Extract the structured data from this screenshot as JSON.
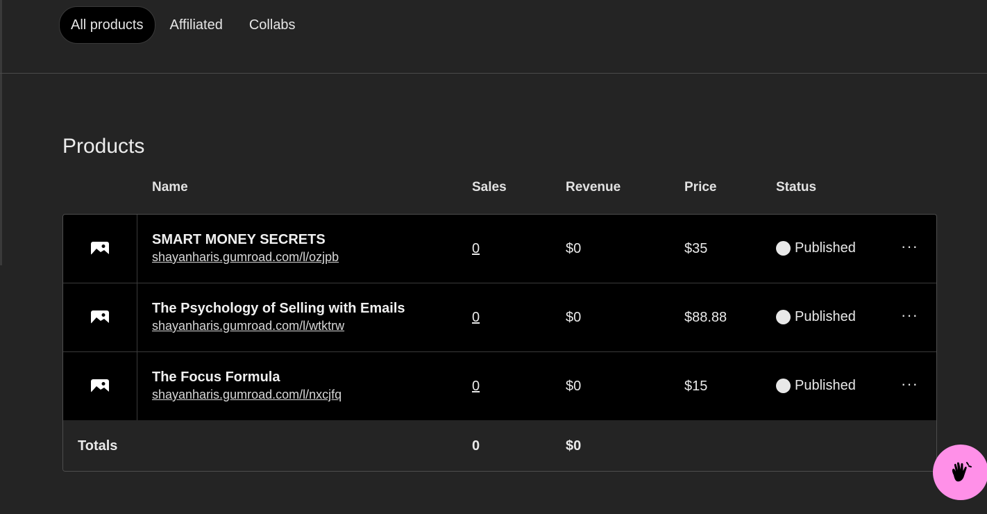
{
  "tabs": [
    {
      "label": "All products",
      "active": true
    },
    {
      "label": "Affiliated",
      "active": false
    },
    {
      "label": "Collabs",
      "active": false
    }
  ],
  "section_title": "Products",
  "columns": {
    "name": "Name",
    "sales": "Sales",
    "revenue": "Revenue",
    "price": "Price",
    "status": "Status"
  },
  "products": [
    {
      "name": "SMART MONEY SECRETS",
      "url": "shayanharis.gumroad.com/l/ozjpb",
      "sales": "0",
      "revenue": "$0",
      "price": "$35",
      "status": "Published",
      "more": "···"
    },
    {
      "name": "The Psychology of Selling with Emails",
      "url": "shayanharis.gumroad.com/l/wtktrw",
      "sales": "0",
      "revenue": "$0",
      "price": "$88.88",
      "status": "Published",
      "more": "···"
    },
    {
      "name": "The Focus Formula",
      "url": "shayanharis.gumroad.com/l/nxcjfq",
      "sales": "0",
      "revenue": "$0",
      "price": "$15",
      "status": "Published",
      "more": "···"
    }
  ],
  "totals": {
    "label": "Totals",
    "sales": "0",
    "revenue": "$0"
  },
  "icons": {
    "thumbnail": "image-placeholder-icon",
    "status": "published-dot-icon",
    "more": "more-horizontal-icon",
    "help": "wave-hand-icon"
  },
  "colors": {
    "background": "#242424",
    "row_background": "#000000",
    "help_button": "#ff90e8"
  }
}
